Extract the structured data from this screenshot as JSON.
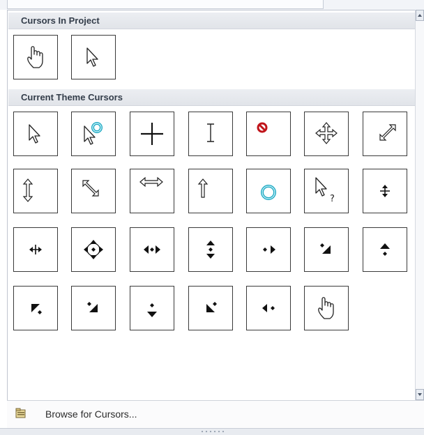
{
  "sections": {
    "project": {
      "title": "Cursors In Project",
      "cursors": [
        "hand-cursor",
        "arrow-cursor"
      ]
    },
    "theme": {
      "title": "Current Theme Cursors",
      "cursors": [
        "arrow-cursor",
        "arrow-busy-cursor",
        "crosshair-cursor",
        "ibeam-cursor",
        "no-cursor",
        "move-cursor",
        "resize-nesw-cursor",
        "resize-ns-cursor",
        "resize-nwse-cursor",
        "resize-we-cursor",
        "up-arrow-cursor",
        "busy-cursor",
        "help-cursor",
        "split-ns-cursor",
        "split-we-cursor",
        "pan-all-cursor",
        "pan-we-cursor",
        "pan-ns-cursor",
        "pan-east-cursor",
        "pan-southeast-cursor",
        "pan-north-cursor",
        "pan-southwest-cursor",
        "pan-south-cursor-alt",
        "pan-south-cursor",
        "pan-northwest-cursor",
        "pan-west-cursor",
        "hand-cursor"
      ]
    }
  },
  "footer": {
    "label": "Browse for Cursors..."
  }
}
